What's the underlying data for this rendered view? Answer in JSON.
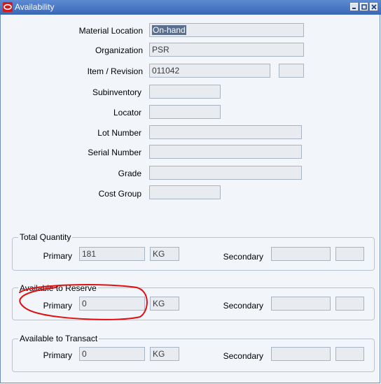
{
  "window": {
    "title": "Availability",
    "icon": "oracle-logo-icon",
    "buttons": [
      "minimize-icon",
      "maximize-icon",
      "close-icon"
    ]
  },
  "form": {
    "material_location": {
      "label": "Material Location",
      "value": "On-hand"
    },
    "organization": {
      "label": "Organization",
      "value": "PSR"
    },
    "item_revision": {
      "label": "Item / Revision",
      "value": "011042",
      "revision": ""
    },
    "subinventory": {
      "label": "Subinventory",
      "value": ""
    },
    "locator": {
      "label": "Locator",
      "value": ""
    },
    "lot_number": {
      "label": "Lot Number",
      "value": ""
    },
    "serial_number": {
      "label": "Serial Number",
      "value": ""
    },
    "grade": {
      "label": "Grade",
      "value": ""
    },
    "cost_group": {
      "label": "Cost Group",
      "value": ""
    }
  },
  "groups": {
    "total_quantity": {
      "title": "Total Quantity",
      "primary_label": "Primary",
      "primary_value": "181",
      "primary_uom": "KG",
      "secondary_label": "Secondary",
      "secondary_value": "",
      "secondary_uom": ""
    },
    "available_to_reserve": {
      "title": "Available to Reserve",
      "primary_label": "Primary",
      "primary_value": "0",
      "primary_uom": "KG",
      "secondary_label": "Secondary",
      "secondary_value": "",
      "secondary_uom": ""
    },
    "available_to_transact": {
      "title": "Available to Transact",
      "primary_label": "Primary",
      "primary_value": "0",
      "primary_uom": "KG",
      "secondary_label": "Secondary",
      "secondary_value": "",
      "secondary_uom": ""
    }
  },
  "colors": {
    "titlebar": "#3b68b6",
    "background": "#f2f5fa",
    "field": "#e8ebf0",
    "annotation": "#e01010"
  }
}
